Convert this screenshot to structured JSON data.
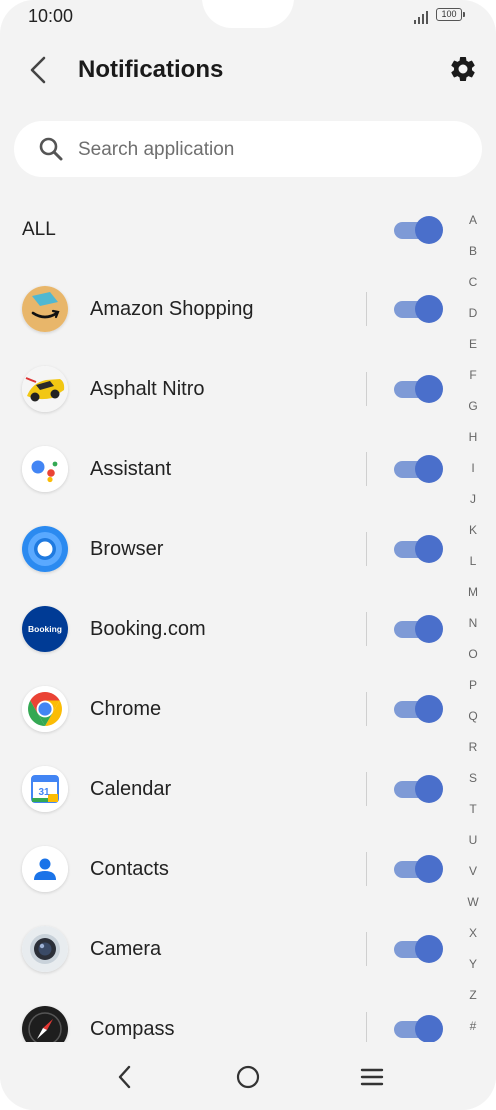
{
  "status_bar": {
    "time": "10:00",
    "battery": "100"
  },
  "header": {
    "title": "Notifications"
  },
  "search": {
    "placeholder": "Search application",
    "value": ""
  },
  "all": {
    "label": "ALL",
    "enabled": true
  },
  "apps": [
    {
      "name": "Amazon Shopping",
      "icon": "amazon-icon",
      "enabled": true
    },
    {
      "name": "Asphalt Nitro",
      "icon": "asphalt-icon",
      "enabled": true
    },
    {
      "name": "Assistant",
      "icon": "assistant-icon",
      "enabled": true
    },
    {
      "name": "Browser",
      "icon": "browser-icon",
      "enabled": true
    },
    {
      "name": "Booking.com",
      "icon": "booking-icon",
      "icon_text": "Booking",
      "enabled": true
    },
    {
      "name": "Chrome",
      "icon": "chrome-icon",
      "enabled": true
    },
    {
      "name": "Calendar",
      "icon": "calendar-icon",
      "icon_text": "31",
      "enabled": true
    },
    {
      "name": "Contacts",
      "icon": "contacts-icon",
      "enabled": true
    },
    {
      "name": "Camera",
      "icon": "camera-icon",
      "enabled": true
    },
    {
      "name": "Compass",
      "icon": "compass-icon",
      "enabled": true
    }
  ],
  "alphabet": [
    "A",
    "B",
    "C",
    "D",
    "E",
    "F",
    "G",
    "H",
    "I",
    "J",
    "K",
    "L",
    "M",
    "N",
    "O",
    "P",
    "Q",
    "R",
    "S",
    "T",
    "U",
    "V",
    "W",
    "X",
    "Y",
    "Z",
    "#"
  ],
  "colors": {
    "toggle_track": "#7e9ad6",
    "toggle_knob": "#4a6fcb",
    "background": "#f3f3f3"
  }
}
